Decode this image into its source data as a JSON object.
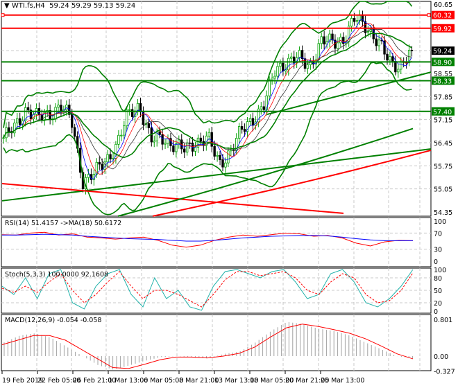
{
  "header": {
    "symbol": "WTI.fs,H4",
    "open": "59.24",
    "high": "59.29",
    "low": "59.13",
    "close": "59.24"
  },
  "colors": {
    "bull": "#00a000",
    "bear": "#000000",
    "red": "#ff0000",
    "green": "#008000",
    "blue": "#0000ff",
    "teal": "#20b2aa"
  },
  "chart_data": [
    {
      "type": "line",
      "name": "price",
      "title": "WTI.fs,H4",
      "ylim": [
        54.35,
        60.65
      ],
      "yticks": [
        "60.65",
        "57.85",
        "57.15",
        "56.45",
        "55.75",
        "55.05",
        "54.35",
        "58.55"
      ],
      "xticks": [
        "19 Feb 2019",
        "22 Feb 05:00",
        "26 Feb 21:00",
        "1 Mar 13:00",
        "6 Mar 05:00",
        "8 Mar 21:00",
        "13 Mar 13:00",
        "18 Mar 05:00",
        "20 Mar 21:00",
        "25 Mar 13:00"
      ],
      "close_path": [
        56.6,
        56.9,
        57.5,
        57.2,
        57.3,
        57.6,
        57.1,
        55.3,
        55.5,
        55.9,
        56.4,
        57.3,
        57.6,
        56.5,
        56.6,
        56.4,
        56.2,
        56.5,
        56.6,
        55.8,
        56.2,
        56.8,
        57.2,
        57.6,
        58.7,
        58.9,
        59.0,
        58.8,
        59.5,
        59.5,
        59.6,
        60.2,
        60.0,
        59.5,
        58.9,
        58.8,
        59.24
      ],
      "levels": [
        {
          "value": "60.32",
          "color": "#ff0000"
        },
        {
          "value": "59.92",
          "color": "#ff0000"
        },
        {
          "value": "58.90",
          "color": "#008000"
        },
        {
          "value": "58.33",
          "color": "#008000"
        },
        {
          "value": "57.40",
          "color": "#008000"
        }
      ],
      "last_price": "59.24"
    },
    {
      "type": "line",
      "name": "rsi",
      "title": "RSI(14) 51.4157  ->MA(18) 50.6172",
      "ylim": [
        0,
        100
      ],
      "yticks": [
        "100",
        "70",
        "30",
        "0"
      ],
      "rsi": [
        66,
        65,
        70,
        72,
        65,
        68,
        60,
        58,
        55,
        58,
        60,
        52,
        40,
        35,
        40,
        52,
        60,
        65,
        62,
        66,
        70,
        68,
        62,
        64,
        58,
        45,
        38,
        48,
        52,
        51
      ],
      "ma": [
        65,
        65,
        66,
        67,
        66,
        65,
        62,
        60,
        58,
        56,
        55,
        54,
        52,
        50,
        50,
        52,
        55,
        58,
        60,
        62,
        63,
        64,
        64,
        63,
        60,
        56,
        53,
        51,
        51,
        51
      ]
    },
    {
      "type": "line",
      "name": "stochastic",
      "title": "Stoch(5,3,3) 100.0000 92.1608",
      "ylim": [
        0,
        100
      ],
      "yticks": [
        "100",
        "80",
        "50",
        "20",
        "0"
      ],
      "k": [
        60,
        40,
        80,
        30,
        90,
        100,
        20,
        5,
        60,
        90,
        100,
        40,
        10,
        80,
        30,
        50,
        10,
        2,
        60,
        95,
        100,
        90,
        80,
        95,
        100,
        70,
        30,
        40,
        90,
        100,
        70,
        20,
        10,
        30,
        60,
        100
      ],
      "d": [
        55,
        45,
        60,
        45,
        70,
        90,
        50,
        20,
        40,
        70,
        95,
        60,
        30,
        50,
        50,
        40,
        25,
        10,
        40,
        75,
        95,
        95,
        85,
        90,
        95,
        80,
        50,
        40,
        70,
        90,
        80,
        40,
        20,
        25,
        50,
        92
      ]
    },
    {
      "type": "bar",
      "name": "macd",
      "title": "MACD(12,26,9) -0.054 -0.058",
      "ylim": [
        -0.327,
        0.801
      ],
      "yticks": [
        "0.801",
        "0.00",
        "-0.327"
      ],
      "macd": [
        0.3,
        0.45,
        0.5,
        0.4,
        0.2,
        0.0,
        -0.2,
        -0.3,
        -0.2,
        -0.1,
        -0.02,
        0.0,
        -0.03,
        -0.05,
        0.05,
        0.1,
        0.3,
        0.55,
        0.75,
        0.7,
        0.6,
        0.55,
        0.45,
        0.3,
        0.15,
        0.0,
        -0.05
      ],
      "signal": [
        0.25,
        0.35,
        0.45,
        0.45,
        0.35,
        0.15,
        -0.05,
        -0.25,
        -0.27,
        -0.18,
        -0.08,
        -0.02,
        -0.02,
        -0.04,
        0.0,
        0.06,
        0.2,
        0.42,
        0.62,
        0.7,
        0.65,
        0.58,
        0.5,
        0.38,
        0.22,
        0.05,
        -0.06
      ]
    }
  ]
}
